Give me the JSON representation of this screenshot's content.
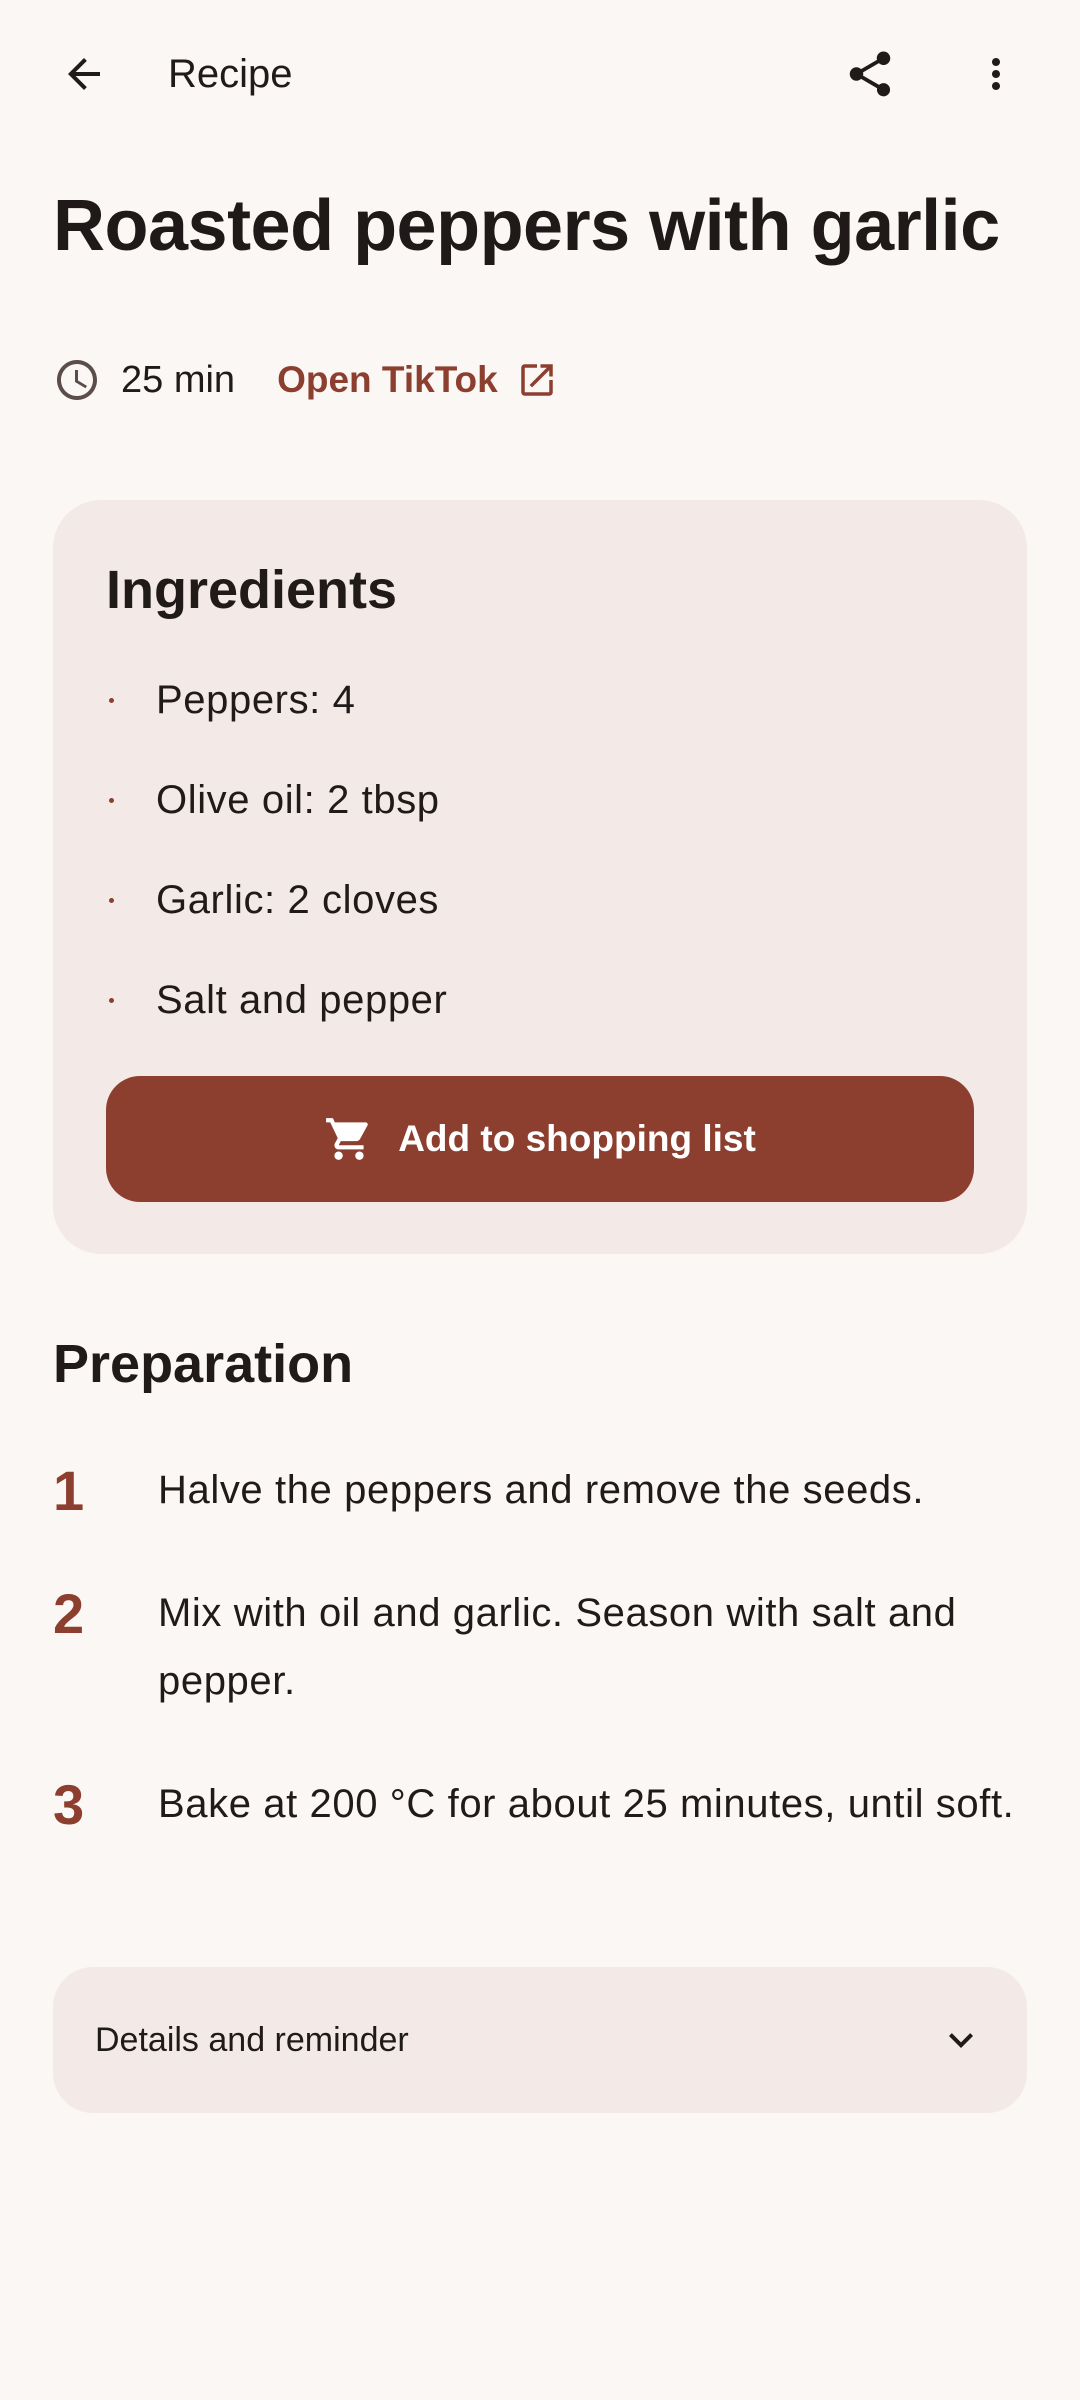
{
  "topbar": {
    "title": "Recipe",
    "back_icon": "arrow-back-icon",
    "share_icon": "share-icon",
    "more_icon": "more-vert-icon"
  },
  "recipe": {
    "title": "Roasted peppers with garlic",
    "time": "25 min",
    "time_icon": "clock-icon",
    "source_link": "Open TikTok",
    "source_icon": "open-external-icon"
  },
  "ingredients": {
    "heading": "Ingredients",
    "items": [
      "Peppers: 4",
      "Olive oil: 2 tbsp",
      "Garlic: 2 cloves",
      "Salt and pepper"
    ],
    "button_label": "Add to shopping list",
    "button_icon": "shopping-cart-icon"
  },
  "preparation": {
    "heading": "Preparation",
    "steps": [
      {
        "number": "1",
        "text": "Halve the peppers and remove the seeds."
      },
      {
        "number": "2",
        "text": "Mix with oil and garlic. Season with salt and pepper."
      },
      {
        "number": "3",
        "text": "Bake at 200 °C for about 25 minutes, until soft."
      }
    ]
  },
  "details": {
    "label": "Details and reminder",
    "icon": "chevron-down-icon"
  },
  "colors": {
    "background": "#fbf7f5",
    "card": "#f3eae7",
    "accent": "#8d3f2f",
    "text": "#201a19"
  }
}
